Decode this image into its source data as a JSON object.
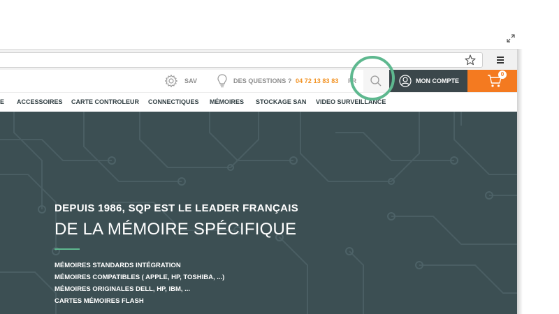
{
  "browser": {
    "icons": [
      "resize-icon",
      "star-icon",
      "menu-icon"
    ]
  },
  "header": {
    "sav_label": "SAV",
    "questions_label": "DES QUESTIONS ?",
    "phone": "04 72 13 83 83",
    "language": "FR",
    "account_label": "MON COMPTE",
    "cart_count": "0",
    "accent_orange": "#f47a20",
    "accent_dark": "#3b474b",
    "highlight_green": "#5eb88f"
  },
  "nav": {
    "items": [
      "E",
      "ACCESSOIRES",
      "CARTE CONTROLEUR",
      "CONNECTIQUES",
      "MÉMOIRES",
      "STOCKAGE SAN",
      "VIDEO SURVEILLANCE"
    ]
  },
  "hero": {
    "kicker": "DEPUIS 1986, SQP EST LE LEADER FRANÇAIS",
    "title": "DE LA MÉMOIRE SPÉCIFIQUE",
    "bullets": [
      "MÉMOIRES STANDARDS INTÉGRATION",
      "MÉMOIRES COMPATIBLES ( APPLE, HP, TOSHIBA, ...)",
      "MÉMOIRES ORIGINALES DELL, HP, IBM, ...",
      "CARTES MÉMOIRES FLASH"
    ],
    "background_color": "#3c4f53"
  }
}
